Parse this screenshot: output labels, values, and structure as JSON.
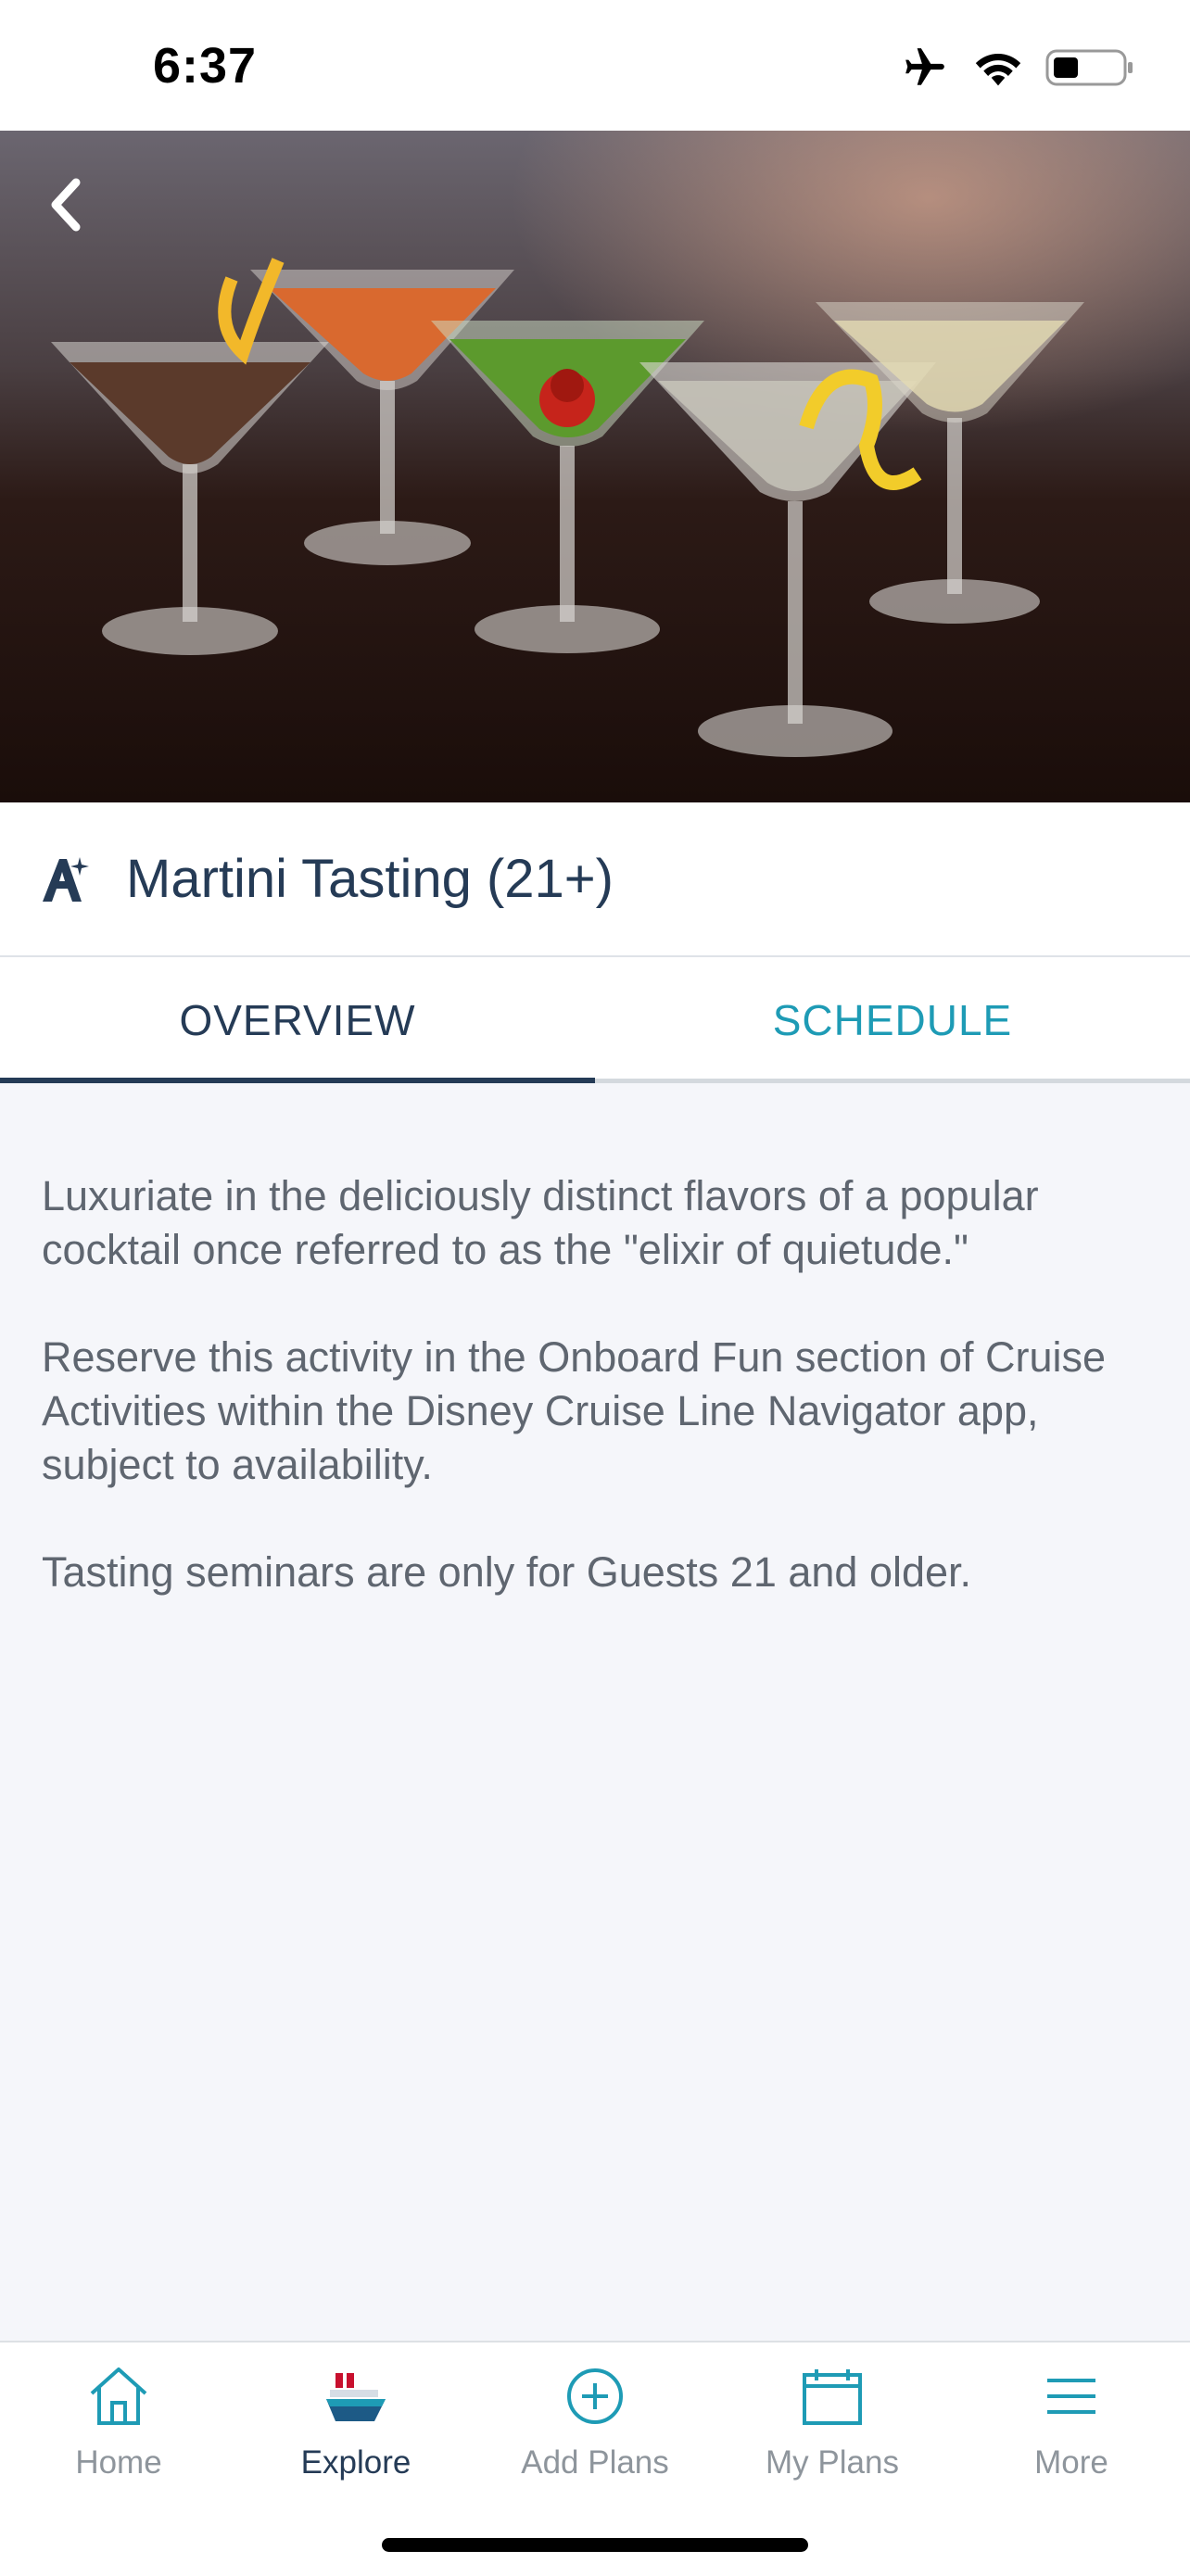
{
  "status_bar": {
    "time": "6:37"
  },
  "header": {
    "title": "Martini Tasting (21+)"
  },
  "tabs": [
    {
      "label": "OVERVIEW",
      "active": true
    },
    {
      "label": "SCHEDULE",
      "active": false
    }
  ],
  "overview": {
    "paragraphs": [
      "Luxuriate in the deliciously distinct flavors of a popular cocktail once referred to as the \"elixir of quietude.\"",
      "Reserve this activity in the Onboard Fun section of Cruise Activities within the Disney Cruise Line Navigator app, subject to availability.",
      "Tasting seminars are only for Guests 21 and older."
    ]
  },
  "bottom_nav": [
    {
      "label": "Home",
      "icon": "home-icon",
      "active": false
    },
    {
      "label": "Explore",
      "icon": "ship-icon",
      "active": true
    },
    {
      "label": "Add Plans",
      "icon": "add-circle-icon",
      "active": false
    },
    {
      "label": "My Plans",
      "icon": "calendar-icon",
      "active": false
    },
    {
      "label": "More",
      "icon": "menu-icon",
      "active": false
    }
  ],
  "colors": {
    "primary": "#253b56",
    "accent": "#1e9bb5",
    "background": "#f5f6fa"
  }
}
